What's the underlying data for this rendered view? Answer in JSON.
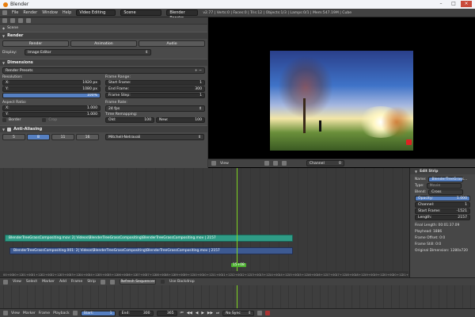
{
  "window": {
    "title": "Blender"
  },
  "menubar": {
    "items": [
      "File",
      "Render",
      "Window",
      "Help"
    ],
    "layout": "Video Editing",
    "scene": "Scene",
    "engine": "Blender Render",
    "stats": "v2.77 | Verts:0 | Faces:0 | Tris:12 | Objects:1/3 | Lamps:0/1 | Mem:547.19M | Cube"
  },
  "properties": {
    "breadcrumb": "Scene",
    "render_panel": "Render",
    "render_buttons": [
      "Render",
      "Animation",
      "Audio"
    ],
    "display_label": "Display:",
    "display_value": "Image Editor",
    "dimensions_panel": "Dimensions",
    "presets": "Render Presets",
    "resolution_label": "Resolution:",
    "res_x_label": "X:",
    "res_x": "1920 px",
    "res_y_label": "Y:",
    "res_y": "1080 px",
    "res_pct": "100%",
    "frame_range_label": "Frame Range:",
    "start_label": "Start Frame:",
    "start_value": "1",
    "end_label": "End Frame:",
    "end_value": "300",
    "step_label": "Frame Step:",
    "step_value": "1",
    "aspect_label": "Aspect Ratio:",
    "aspect_x_label": "X:",
    "aspect_x": "1.000",
    "aspect_y_label": "Y:",
    "aspect_y": "1.000",
    "frame_rate_label": "Frame Rate:",
    "fps": "24 fps",
    "time_remap_label": "Time Remapping:",
    "old_label": "Old:",
    "old_value": "100",
    "new_label": "New:",
    "new_value": "100",
    "border_label": "Border",
    "crop_label": "Crop",
    "aa_panel": "Anti-Aliasing",
    "aa_samples": [
      "5",
      "8",
      "11",
      "16"
    ],
    "aa_filter": "Mitchell-Netravali"
  },
  "viewer": {
    "header_items": [
      "View"
    ],
    "channel": "Channel",
    "channel_value": "0"
  },
  "sequencer": {
    "strip_green": "BlenderTreeGrassCompositing.mov: 2| Videos\\BlenderTreeGrassCompositing\\BlenderTreeGrassCompositing.mov | 2157",
    "strip_blue": "BlenderTreeGrassCompositing.001: 2| Videos\\BlenderTreeGrassCompositing\\BlenderTreeGrassCompositing.mov | 2157",
    "playhead_label": "15+08",
    "header_items": [
      "View",
      "Select",
      "Marker",
      "Add",
      "Frame",
      "Strip"
    ],
    "refresh": "Refresh Sequencer",
    "use_backdrop": "Use Backdrop",
    "ticks": [
      "00+00",
      "00+12",
      "01+00",
      "01+12",
      "02+00",
      "02+12",
      "03+00",
      "03+12",
      "04+00",
      "04+12",
      "05+00",
      "05+12",
      "06+00",
      "06+12",
      "07+00",
      "07+12",
      "08+00",
      "08+12",
      "09+00",
      "09+12",
      "10+00",
      "10+12",
      "11+00",
      "11+12",
      "12+00",
      "12+12",
      "13+00",
      "13+12",
      "14+00",
      "14+12",
      "15+00",
      "15+12",
      "16+00",
      "16+12",
      "17+00",
      "17+12",
      "18+00",
      "18+12",
      "19+00",
      "19+12",
      "20+00",
      "20+12",
      "21+00"
    ]
  },
  "strip_panel": {
    "title": "Edit Strip",
    "name_label": "Name:",
    "name_value": "BlenderTreeGrass...",
    "type_label": "Type:",
    "type_value": "Movie",
    "blend_label": "Blend:",
    "blend_value": "Cross",
    "opacity_label": "Opacity:",
    "opacity_value": "1.000",
    "channel_label": "Channel:",
    "channel_value": "1",
    "start_label": "Start Frame:",
    "start_value": "-1521",
    "length_label": "Length:",
    "length_value": "2157",
    "final_length": "Final Length: 00:01:37.09",
    "playhead": "Playhead: 1886",
    "frame_offset": "Frame Offset: 0:0",
    "frame_still": "Frame Still: 0:0",
    "orig_dim": "Original Dimension: 1280x720"
  },
  "timeline": {
    "header_items": [
      "View",
      "Marker",
      "Frame",
      "Playback"
    ],
    "start_label": "Start:",
    "start_value": "1",
    "end_label": "End:",
    "end_value": "300",
    "current": "365",
    "sync": "No Sync"
  },
  "colors": {
    "strip_green": "#2f9c86",
    "strip_blue": "#3d5a92",
    "playhead": "#7ed321",
    "accent": "#5680c2"
  }
}
